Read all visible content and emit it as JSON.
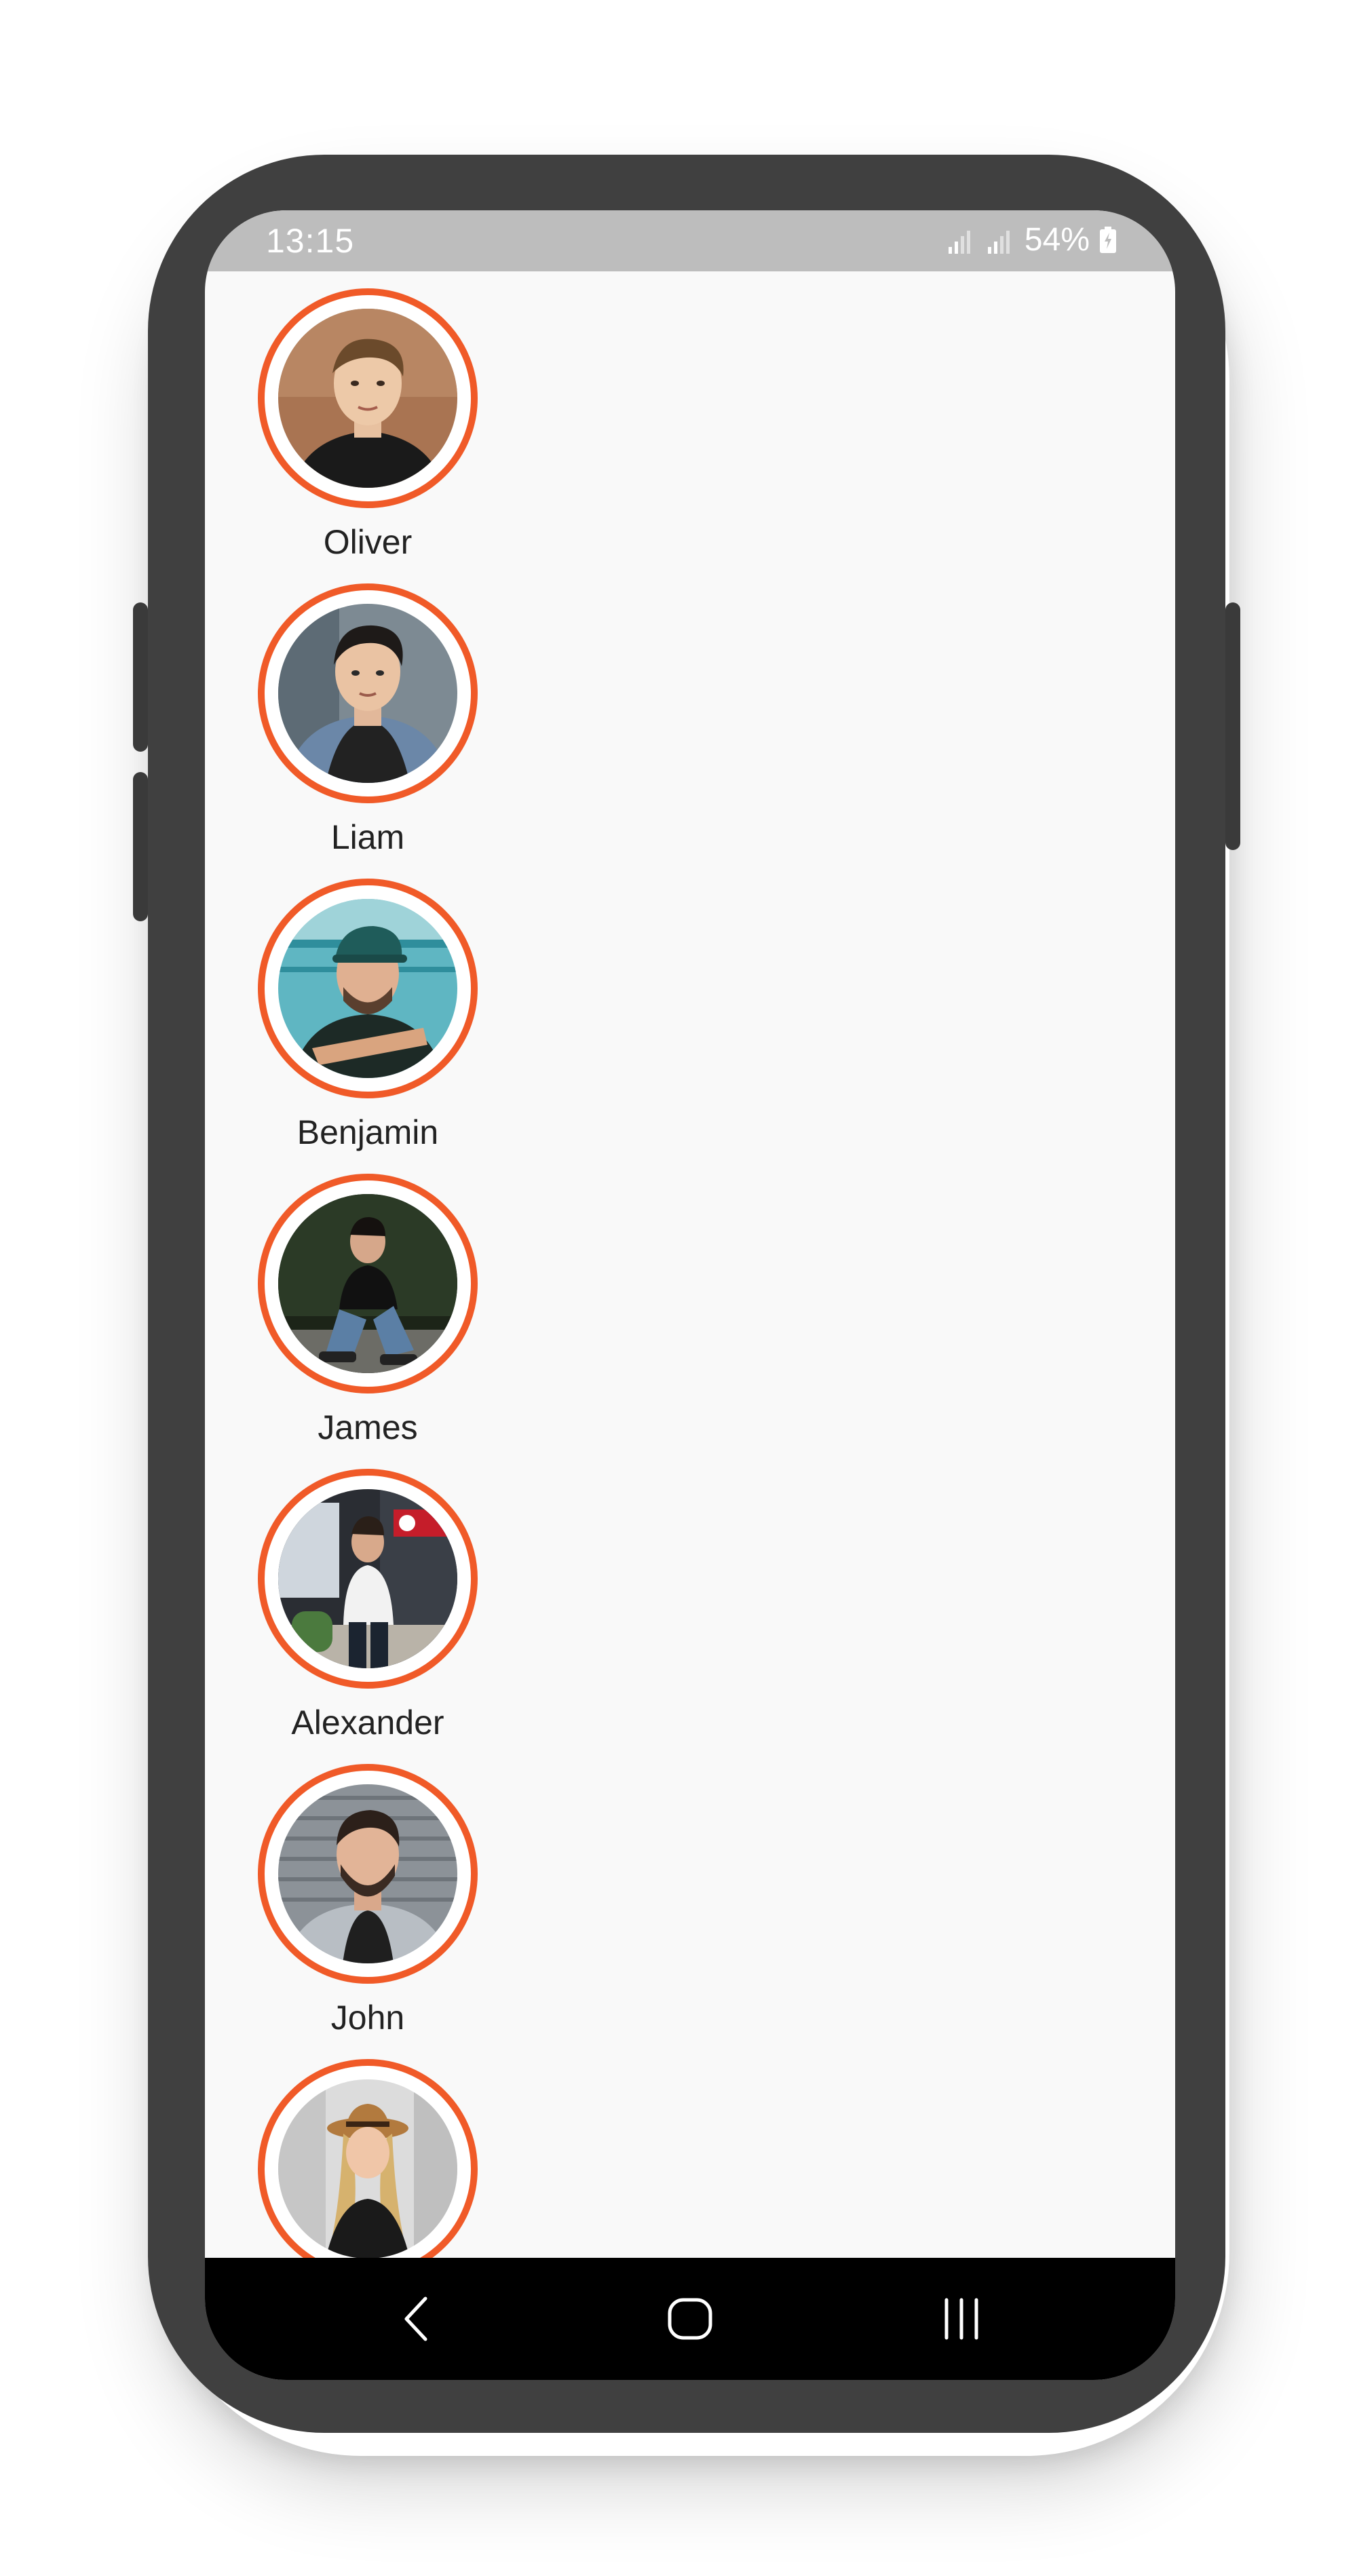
{
  "status_bar": {
    "time": "13:15",
    "battery_percent": "54%",
    "signal_icon_1": "signal-icon",
    "signal_icon_2": "signal-icon",
    "battery_icon": "battery-charging-icon"
  },
  "colors": {
    "ring": "#f05a28",
    "screen_bg": "#f9f9f9",
    "status_bar_bg": "#bdbdbd",
    "nav_bar_bg": "#000000",
    "phone_frame": "#404040"
  },
  "stories": [
    {
      "name": "Oliver",
      "avatar": "profile-photo"
    },
    {
      "name": "Liam",
      "avatar": "profile-photo"
    },
    {
      "name": "Benjamin",
      "avatar": "profile-photo"
    },
    {
      "name": "James",
      "avatar": "profile-photo"
    },
    {
      "name": "Alexander",
      "avatar": "profile-photo"
    },
    {
      "name": "John",
      "avatar": "profile-photo"
    },
    {
      "name": "",
      "avatar": "profile-photo"
    }
  ],
  "nav_bar": {
    "back_icon": "back-chevron-icon",
    "home_icon": "home-icon",
    "recents_icon": "recents-icon"
  }
}
